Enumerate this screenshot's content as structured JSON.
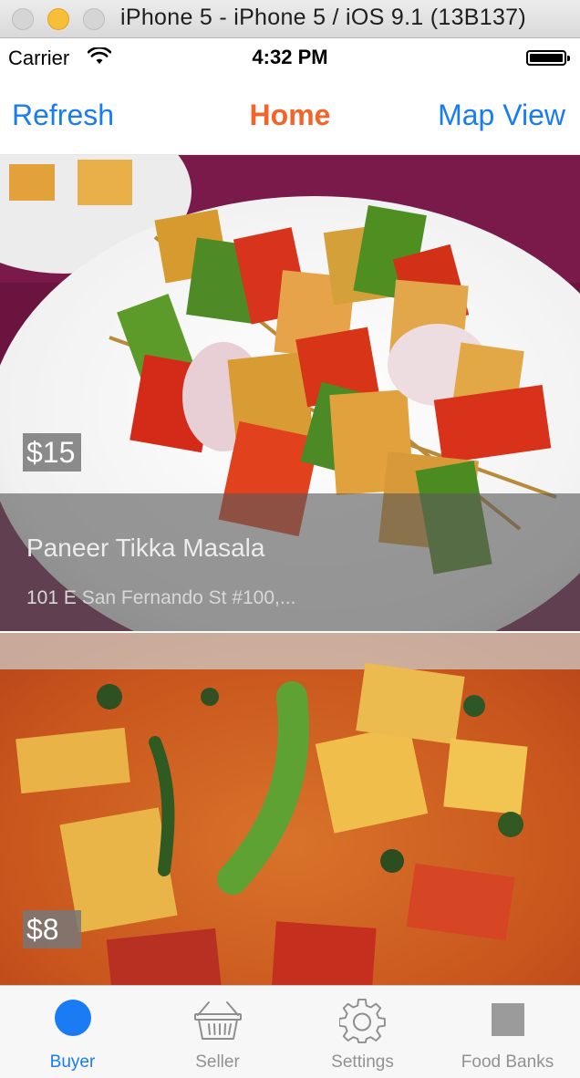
{
  "window": {
    "title": "iPhone 5 - iPhone 5 / iOS 9.1 (13B137)"
  },
  "status_bar": {
    "carrier": "Carrier",
    "time": "4:32 PM",
    "icons": [
      "wifi-icon",
      "battery-icon"
    ]
  },
  "nav": {
    "left_button": "Refresh",
    "title": "Home",
    "right_button": "Map View",
    "colors": {
      "buttons": "#1a7cf5",
      "title": "#f2642a"
    }
  },
  "feed": {
    "items": [
      {
        "price": "$15",
        "name": "Paneer Tikka Masala",
        "address": "101 E San Fernando St #100,..."
      },
      {
        "price": "$8"
      }
    ]
  },
  "tabs": [
    {
      "label": "Buyer",
      "icon": "circle-icon",
      "active": true
    },
    {
      "label": "Seller",
      "icon": "basket-icon",
      "active": false
    },
    {
      "label": "Settings",
      "icon": "gear-icon",
      "active": false
    },
    {
      "label": "Food Banks",
      "icon": "square-icon",
      "active": false
    }
  ]
}
